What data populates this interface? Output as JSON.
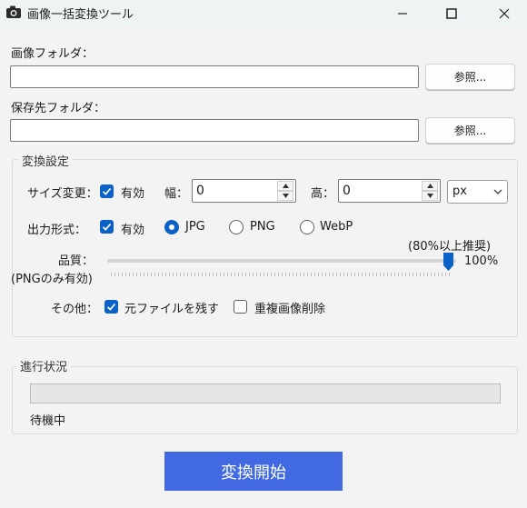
{
  "window": {
    "title": "画像一括変換ツール",
    "icon": "camera-icon",
    "controls": [
      "minimize-icon",
      "maximize-icon",
      "close-icon"
    ]
  },
  "image_folder": {
    "label": "画像フォルダ：",
    "value": "",
    "browse_label": "参照..."
  },
  "output_folder": {
    "label": "保存先フォルダ：",
    "value": "",
    "browse_label": "参照..."
  },
  "conversion": {
    "group_title": "変換設定",
    "resize": {
      "label": "サイズ変更：",
      "enabled_label": "有効",
      "enabled": true,
      "width_label": "幅：",
      "width_value": "0",
      "height_label": "高：",
      "height_value": "0",
      "unit": "px"
    },
    "format": {
      "label": "出力形式：",
      "enabled_label": "有効",
      "enabled": true,
      "options": [
        "JPG",
        "PNG",
        "WebP"
      ],
      "selected": "JPG"
    },
    "quality": {
      "label": "品質：",
      "note": "(PNGのみ有効)",
      "hint": "(80%以上推奨)",
      "value_text": "100%",
      "value_fraction": 1.0
    },
    "other": {
      "label": "その他：",
      "keep_original_label": "元ファイルを残す",
      "keep_original": true,
      "delete_duplicates_label": "重複画像削除",
      "delete_duplicates": false
    }
  },
  "progress": {
    "group_title": "進行状況",
    "value_fraction": 0,
    "status": "待機中"
  },
  "start_button": {
    "label": "変換開始"
  },
  "colors": {
    "accent": "#0a61c8",
    "primary_button": "#4169e1",
    "titlebar": "#eef3f4"
  }
}
